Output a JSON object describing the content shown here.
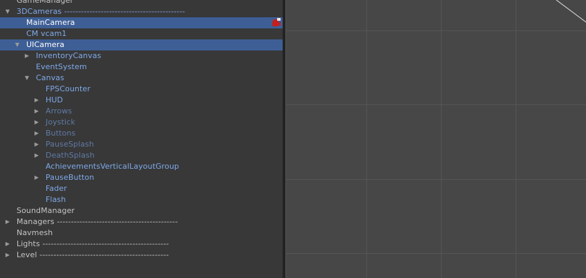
{
  "hierarchy": {
    "rows": [
      {
        "label": "GameManager",
        "depth": 0,
        "expander": "none",
        "color": "light",
        "selected": false
      },
      {
        "label": "3DCameras -------------------------------------------",
        "depth": 0,
        "expander": "expanded",
        "color": "blue",
        "selected": false
      },
      {
        "label": "MainCamera",
        "depth": 1,
        "expander": "none",
        "color": "white",
        "selected": true,
        "badge": "camera-warning-icon"
      },
      {
        "label": "CM vcam1",
        "depth": 1,
        "expander": "none",
        "color": "blue",
        "selected": false
      },
      {
        "label": "UICamera",
        "depth": 1,
        "expander": "expanded",
        "color": "white",
        "selected": true
      },
      {
        "label": "InventoryCanvas",
        "depth": 2,
        "expander": "collapsed",
        "color": "blue",
        "selected": false
      },
      {
        "label": "EventSystem",
        "depth": 2,
        "expander": "none",
        "color": "blue",
        "selected": false
      },
      {
        "label": "Canvas",
        "depth": 2,
        "expander": "expanded",
        "color": "blue",
        "selected": false
      },
      {
        "label": "FPSCounter",
        "depth": 3,
        "expander": "none",
        "color": "blue",
        "selected": false
      },
      {
        "label": "HUD",
        "depth": 3,
        "expander": "collapsed",
        "color": "blue",
        "selected": false
      },
      {
        "label": "Arrows",
        "depth": 3,
        "expander": "collapsed",
        "color": "dim",
        "selected": false
      },
      {
        "label": "Joystick",
        "depth": 3,
        "expander": "collapsed",
        "color": "dim",
        "selected": false
      },
      {
        "label": "Buttons",
        "depth": 3,
        "expander": "collapsed",
        "color": "dim",
        "selected": false
      },
      {
        "label": "PauseSplash",
        "depth": 3,
        "expander": "collapsed",
        "color": "dim",
        "selected": false
      },
      {
        "label": "DeathSplash",
        "depth": 3,
        "expander": "collapsed",
        "color": "dim",
        "selected": false
      },
      {
        "label": "AchievementsVerticalLayoutGroup",
        "depth": 3,
        "expander": "none",
        "color": "blue",
        "selected": false
      },
      {
        "label": "PauseButton",
        "depth": 3,
        "expander": "collapsed",
        "color": "blue",
        "selected": false
      },
      {
        "label": "Fader",
        "depth": 3,
        "expander": "none",
        "color": "blue",
        "selected": false
      },
      {
        "label": "Flash",
        "depth": 3,
        "expander": "none",
        "color": "blue",
        "selected": false
      },
      {
        "label": "SoundManager",
        "depth": 0,
        "expander": "none",
        "color": "light",
        "selected": false
      },
      {
        "label": "Managers -------------------------------------------",
        "depth": 0,
        "expander": "collapsed",
        "color": "light",
        "selected": false
      },
      {
        "label": "Navmesh",
        "depth": 0,
        "expander": "none",
        "color": "light",
        "selected": false
      },
      {
        "label": "Lights ---------------------------------------------",
        "depth": 0,
        "expander": "collapsed",
        "color": "light",
        "selected": false
      },
      {
        "label": "Level ----------------------------------------------",
        "depth": 0,
        "expander": "collapsed",
        "color": "light",
        "selected": false
      }
    ]
  },
  "colors": {
    "panel_bg": "#383838",
    "selection": "#3e5f96",
    "text_light": "#c4c4c4",
    "text_blue": "#7fa9ea",
    "text_dim": "#5f7aa6",
    "scene_bg": "#474747",
    "grid_line": "#555555"
  }
}
